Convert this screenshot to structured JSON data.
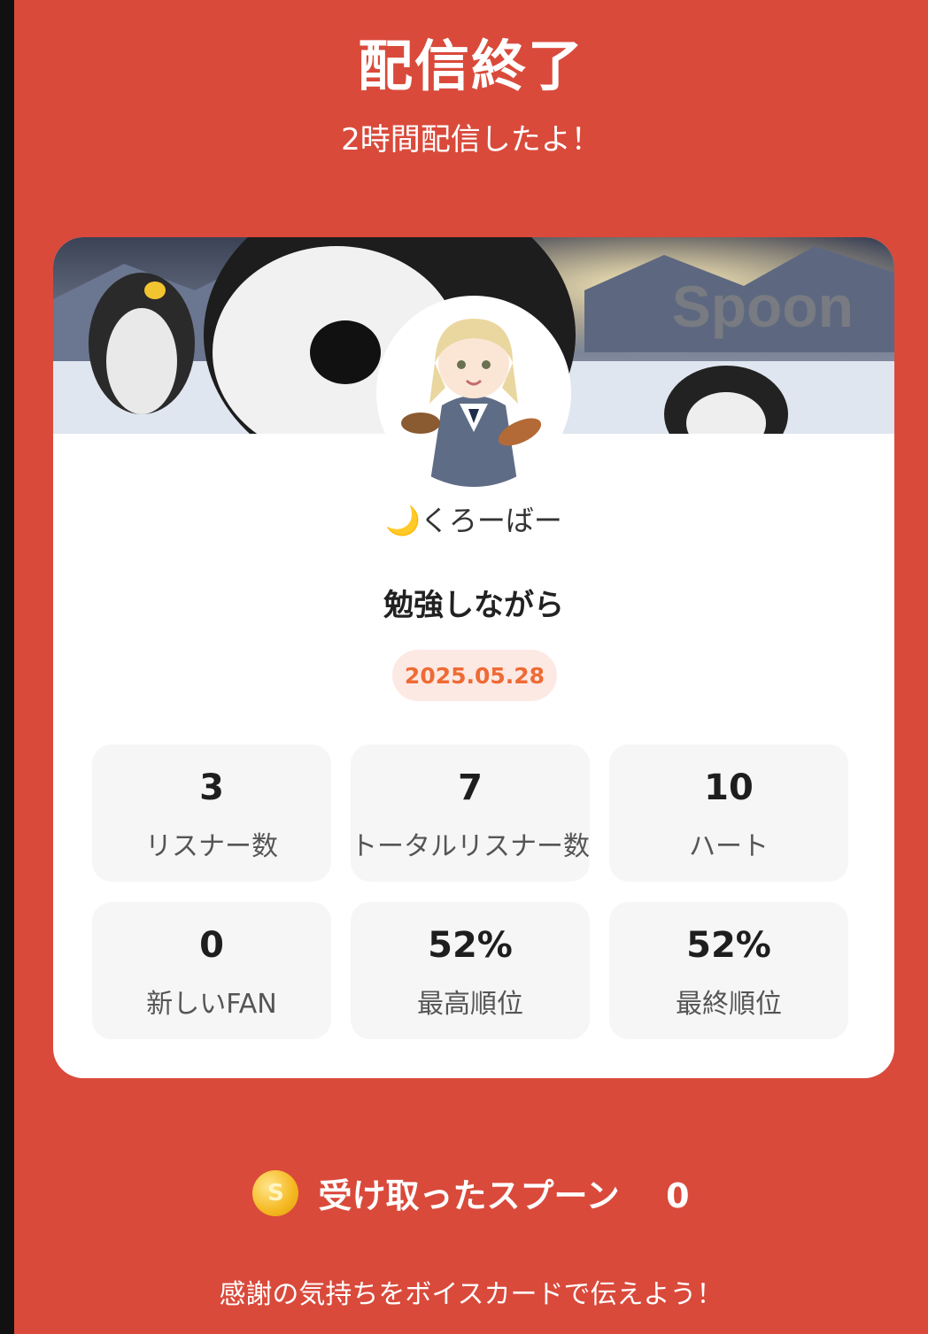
{
  "header": {
    "title": "配信終了",
    "subtitle": "2時間配信したよ！"
  },
  "card": {
    "banner_watermark": "Spoon",
    "username": "🌙くろーばー",
    "stream_title": "勉強しながら",
    "date": "2025.05.28",
    "stats": [
      {
        "value": "3",
        "label": "リスナー数"
      },
      {
        "value": "7",
        "label": "トータルリスナー数"
      },
      {
        "value": "10",
        "label": "ハート"
      },
      {
        "value": "0",
        "label": "新しいFAN"
      },
      {
        "value": "52%",
        "label": "最高順位"
      },
      {
        "value": "52%",
        "label": "最終順位"
      }
    ]
  },
  "spoons": {
    "coin_letter": "S",
    "label": "受け取ったスプーン",
    "count": "0"
  },
  "footer": {
    "message": "感謝の気持ちをボイスカードで伝えよう！"
  },
  "colors": {
    "background": "#d94a3b",
    "card": "#ffffff",
    "date_text": "#ee6b35",
    "date_badge": "#fde9e3",
    "stat_tile": "#f6f6f6"
  }
}
